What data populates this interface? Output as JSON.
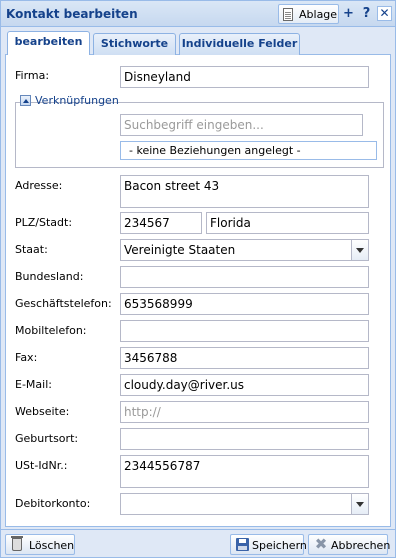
{
  "window": {
    "title": "Kontakt bearbeiten",
    "ablage_label": "Ablage",
    "plus_label": "+",
    "help_label": "?",
    "close_label": "✕"
  },
  "tabs": [
    {
      "label": "bearbeiten",
      "active": true
    },
    {
      "label": "Stichworte",
      "active": false
    },
    {
      "label": "Individuelle Felder",
      "active": false
    }
  ],
  "form": {
    "firma": {
      "label": "Firma:",
      "value": "Disneyland"
    },
    "verknuepfungen": {
      "title": "Verknüpfungen",
      "search_placeholder": "Suchbegriff eingeben...",
      "empty_text": "-  keine Beziehungen angelegt  -"
    },
    "adresse": {
      "label": "Adresse:",
      "value": "Bacon street 43"
    },
    "plz_stadt": {
      "label": "PLZ/Stadt:",
      "plz": "234567",
      "stadt": "Florida"
    },
    "staat": {
      "label": "Staat:",
      "value": "Vereinigte Staaten"
    },
    "bundesland": {
      "label": "Bundesland:",
      "value": ""
    },
    "geschaeftstelefon": {
      "label": "Geschäftstelefon:",
      "value": "653568999"
    },
    "mobiltelefon": {
      "label": "Mobiltelefon:",
      "value": ""
    },
    "fax": {
      "label": "Fax:",
      "value": "3456788"
    },
    "email": {
      "label": "E-Mail:",
      "value": "cloudy.day@river.us"
    },
    "webseite": {
      "label": "Webseite:",
      "placeholder": "http://"
    },
    "geburtsort": {
      "label": "Geburtsort:",
      "value": ""
    },
    "ust_idnr": {
      "label": "USt-IdNr.:",
      "value": "2344556787"
    },
    "debitorkonto": {
      "label": "Debitorkonto:",
      "value": ""
    }
  },
  "footer": {
    "delete_label": "Löschen",
    "save_label": "Speichern",
    "cancel_label": "Abbrechen"
  }
}
